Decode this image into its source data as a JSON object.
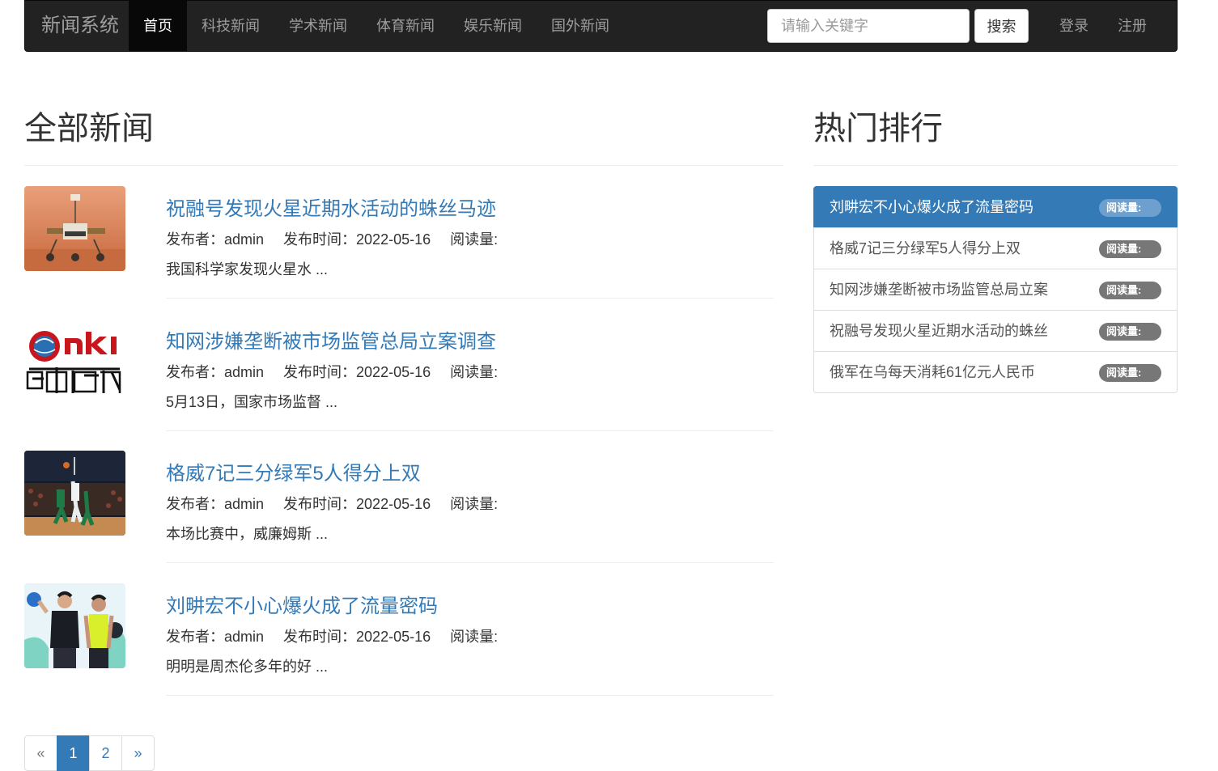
{
  "navbar": {
    "brand": "新闻系统",
    "items": [
      {
        "label": "首页",
        "active": true
      },
      {
        "label": "科技新闻"
      },
      {
        "label": "学术新闻"
      },
      {
        "label": "体育新闻"
      },
      {
        "label": "娱乐新闻"
      },
      {
        "label": "国外新闻"
      }
    ],
    "search": {
      "placeholder": "请输入关键字",
      "button": "搜索"
    },
    "login": "登录",
    "register": "注册"
  },
  "main": {
    "title": "全部新闻",
    "news": [
      {
        "title": "祝融号发现火星近期水活动的蛛丝马迹",
        "author": "发布者：admin",
        "time": "发布时间：2022-05-16",
        "reads": "阅读量:",
        "summary": "我国科学家发现火星水 ...",
        "thumb": "mars-rover-image"
      },
      {
        "title": "知网涉嫌垄断被市场监管总局立案调查",
        "author": "发布者：admin",
        "time": "发布时间：2022-05-16",
        "reads": "阅读量:",
        "summary": "5月13日，国家市场监督 ...",
        "thumb": "cnki-logo-image",
        "logo_text": "CNKI 中国知网"
      },
      {
        "title": "格威7记三分绿军5人得分上双",
        "author": "发布者：admin",
        "time": "发布时间：2022-05-16",
        "reads": "阅读量:",
        "summary": "本场比赛中，威廉姆斯 ...",
        "thumb": "basketball-game-image"
      },
      {
        "title": "刘畊宏不小心爆火成了流量密码",
        "author": "发布者：admin",
        "time": "发布时间：2022-05-16",
        "reads": "阅读量:",
        "summary": "明明是周杰伦多年的好 ...",
        "thumb": "fitness-coaches-image"
      }
    ]
  },
  "sidebar": {
    "title": "热门排行",
    "items": [
      {
        "label": "刘畊宏不小心爆火成了流量密码",
        "badge": "阅读量:",
        "active": true
      },
      {
        "label": "格威7记三分绿军5人得分上双",
        "badge": "阅读量:"
      },
      {
        "label": "知网涉嫌垄断被市场监管总局立案",
        "badge": "阅读量:"
      },
      {
        "label": "祝融号发现火星近期水活动的蛛丝",
        "badge": "阅读量:"
      },
      {
        "label": "俄军在乌每天消耗61亿元人民币",
        "badge": "阅读量:"
      }
    ]
  },
  "pagination": {
    "prev": "«",
    "pages": [
      "1",
      "2"
    ],
    "current": "1",
    "next": "»"
  },
  "colors": {
    "navbar_bg": "#222222",
    "link": "#337ab7",
    "active_list": "#337ab7",
    "badge": "#777777"
  }
}
